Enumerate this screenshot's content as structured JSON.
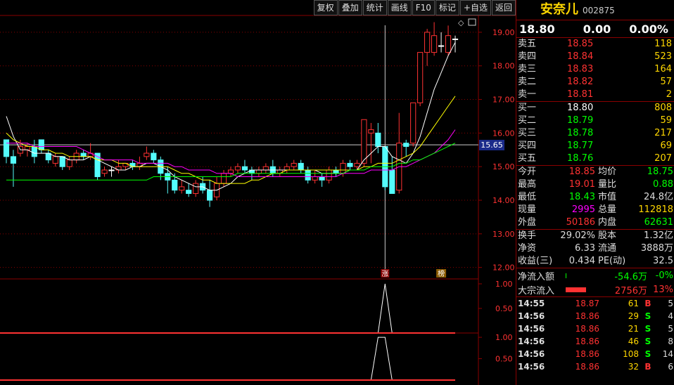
{
  "toolbar": {
    "buttons": [
      "复权",
      "叠加",
      "统计",
      "画线",
      "F10",
      "标记",
      "+自选",
      "返回"
    ]
  },
  "colors": {
    "up": "#ff3232",
    "down": "#54fcfc",
    "equal": "#ffffff",
    "ma5": "#ffffff",
    "ma10": "#ffff00",
    "ma20": "#ff00ff",
    "ma60": "#00ff00",
    "vol_bar": "#ff3232",
    "vol_line": "#ffffff"
  },
  "main_chart": {
    "y_ticks": [
      "19.00",
      "18.00",
      "17.00",
      "16.00",
      "15.00",
      "14.00",
      "13.00",
      "12.00"
    ],
    "price_line_label": "15.65",
    "markers": [
      "涨",
      "榜"
    ]
  },
  "indicator1": {
    "y_ticks": [
      "1.00",
      "0.50"
    ]
  },
  "indicator2": {
    "y_ticks": [
      "1.00",
      "0.50"
    ]
  },
  "chart_data": {
    "type": "candlestick",
    "ylim": [
      11.7,
      19.5
    ],
    "candles": [
      [
        15.8,
        15.3,
        15.8,
        15.1
      ],
      [
        15.3,
        15.1,
        15.5,
        14.4
      ],
      [
        15.4,
        15.6,
        15.8,
        15.3
      ],
      [
        15.5,
        15.6,
        15.7,
        15.3
      ],
      [
        15.6,
        15.3,
        15.8,
        15.1
      ],
      [
        15.8,
        15.5,
        15.8,
        15.4
      ],
      [
        15.4,
        15.2,
        15.5,
        15.1
      ],
      [
        15.1,
        15.3,
        15.4,
        15.0
      ],
      [
        15.3,
        15.0,
        15.3,
        14.9
      ],
      [
        15.0,
        15.2,
        15.3,
        14.9
      ],
      [
        15.2,
        15.4,
        15.5,
        15.1
      ],
      [
        15.4,
        15.3,
        15.5,
        15.2
      ],
      [
        15.3,
        15.4,
        15.7,
        15.2
      ],
      [
        15.4,
        14.7,
        15.4,
        14.6
      ],
      [
        14.8,
        14.9,
        15.0,
        14.7
      ],
      [
        14.9,
        14.9,
        15.0,
        14.7
      ],
      [
        14.9,
        15.0,
        15.2,
        14.8
      ],
      [
        15.0,
        15.1,
        15.1,
        14.9
      ],
      [
        15.1,
        15.0,
        15.2,
        14.9
      ],
      [
        15.0,
        15.1,
        15.3,
        14.9
      ],
      [
        15.3,
        15.4,
        15.6,
        15.2
      ],
      [
        15.4,
        15.2,
        15.5,
        15.1
      ],
      [
        15.2,
        14.8,
        15.3,
        14.6
      ],
      [
        14.8,
        14.6,
        15.0,
        14.2
      ],
      [
        14.6,
        14.3,
        14.8,
        14.2
      ],
      [
        14.3,
        14.4,
        14.6,
        14.2
      ],
      [
        14.3,
        14.2,
        14.5,
        14.1
      ],
      [
        14.2,
        14.5,
        14.6,
        14.1
      ],
      [
        14.5,
        14.3,
        14.7,
        14.2
      ],
      [
        14.3,
        14.0,
        14.6,
        13.8
      ],
      [
        14.1,
        14.5,
        14.7,
        14.0
      ],
      [
        14.5,
        14.8,
        14.9,
        14.4
      ],
      [
        14.8,
        14.9,
        15.0,
        14.7
      ],
      [
        14.9,
        15.0,
        15.1,
        14.8
      ],
      [
        15.0,
        14.9,
        15.2,
        14.8
      ],
      [
        14.9,
        14.8,
        15.0,
        14.6
      ],
      [
        14.8,
        14.9,
        15.0,
        14.7
      ],
      [
        14.9,
        15.0,
        15.1,
        14.8
      ],
      [
        15.0,
        14.8,
        15.2,
        14.7
      ],
      [
        14.8,
        14.9,
        15.0,
        14.7
      ],
      [
        14.9,
        15.0,
        15.1,
        14.8
      ],
      [
        15.0,
        15.1,
        15.2,
        14.9
      ],
      [
        15.1,
        14.9,
        15.2,
        14.8
      ],
      [
        14.9,
        14.6,
        15.0,
        14.5
      ],
      [
        14.6,
        14.7,
        14.9,
        14.5
      ],
      [
        14.7,
        14.6,
        14.8,
        14.4
      ],
      [
        14.6,
        14.9,
        15.0,
        14.5
      ],
      [
        14.9,
        14.8,
        15.0,
        14.7
      ],
      [
        14.8,
        15.1,
        15.2,
        14.7
      ],
      [
        15.1,
        15.0,
        15.2,
        14.9
      ],
      [
        15.0,
        15.1,
        15.2,
        14.9
      ],
      [
        15.1,
        16.4,
        16.4,
        15.0
      ],
      [
        16.0,
        16.1,
        16.3,
        15.1
      ],
      [
        16.0,
        15.6,
        16.3,
        15.4
      ],
      [
        15.6,
        14.4,
        15.6,
        14.3
      ],
      [
        14.9,
        14.2,
        15.3,
        14.2
      ],
      [
        14.3,
        15.7,
        16.6,
        14.2
      ],
      [
        15.7,
        15.6,
        15.8,
        15.3
      ],
      [
        15.7,
        16.9,
        16.9,
        15.6
      ],
      [
        16.9,
        18.4,
        18.4,
        16.8
      ],
      [
        18.4,
        19.0,
        19.1,
        18.0
      ],
      [
        18.4,
        18.9,
        19.3,
        18.3
      ],
      [
        18.6,
        18.6,
        19.0,
        18.4
      ],
      [
        18.4,
        18.9,
        19.2,
        18.3
      ],
      [
        18.8,
        18.8,
        18.9,
        18.4
      ]
    ],
    "ma": {
      "ma5": [
        16.5,
        15.9,
        15.5,
        15.5,
        15.4,
        15.4,
        15.4,
        15.3,
        15.3,
        15.2,
        15.2,
        15.2,
        15.3,
        15.2,
        15.1,
        15.0,
        14.9,
        14.9,
        15.0,
        15.0,
        15.1,
        15.1,
        15.0,
        14.9,
        14.7,
        14.6,
        14.5,
        14.4,
        14.4,
        14.3,
        14.3,
        14.4,
        14.5,
        14.7,
        14.8,
        14.9,
        14.9,
        14.9,
        14.9,
        14.9,
        14.9,
        14.9,
        14.9,
        14.9,
        14.9,
        14.8,
        14.8,
        14.8,
        14.8,
        14.9,
        14.9,
        15.2,
        15.4,
        15.6,
        15.6,
        15.3,
        15.2,
        15.1,
        15.4,
        15.9,
        16.6,
        17.3,
        17.8,
        18.3,
        18.7
      ],
      "ma10": [
        16.0,
        15.8,
        15.7,
        15.6,
        15.6,
        15.5,
        15.5,
        15.4,
        15.4,
        15.3,
        15.3,
        15.3,
        15.3,
        15.2,
        15.2,
        15.2,
        15.1,
        15.1,
        15.0,
        15.0,
        15.0,
        15.0,
        15.0,
        15.0,
        14.9,
        14.8,
        14.8,
        14.7,
        14.6,
        14.6,
        14.5,
        14.5,
        14.5,
        14.5,
        14.5,
        14.6,
        14.6,
        14.7,
        14.8,
        14.8,
        14.9,
        14.9,
        14.9,
        14.9,
        14.9,
        14.9,
        14.9,
        14.9,
        14.9,
        14.9,
        14.9,
        15.0,
        15.0,
        15.1,
        15.1,
        15.1,
        15.2,
        15.3,
        15.4,
        15.6,
        15.9,
        16.2,
        16.5,
        16.8,
        17.1
      ],
      "ma20": [
        15.7,
        15.7,
        15.7,
        15.7,
        15.6,
        15.6,
        15.6,
        15.6,
        15.6,
        15.6,
        15.6,
        15.5,
        15.4,
        15.3,
        15.2,
        15.2,
        15.2,
        15.2,
        15.2,
        15.1,
        15.1,
        15.1,
        15.1,
        15.1,
        15.0,
        15.0,
        14.9,
        14.9,
        14.9,
        14.9,
        14.8,
        14.8,
        14.8,
        14.7,
        14.7,
        14.7,
        14.7,
        14.7,
        14.7,
        14.7,
        14.7,
        14.7,
        14.7,
        14.7,
        14.7,
        14.7,
        14.7,
        14.7,
        14.8,
        14.8,
        14.8,
        14.8,
        14.9,
        14.9,
        14.9,
        14.9,
        15.0,
        15.0,
        15.1,
        15.2,
        15.3,
        15.4,
        15.6,
        15.8,
        16.1
      ],
      "ma60": [
        14.6,
        14.6,
        14.6,
        14.6,
        14.6,
        14.6,
        14.6,
        14.6,
        14.6,
        14.6,
        14.6,
        14.6,
        14.6,
        14.6,
        14.6,
        14.6,
        14.6,
        14.6,
        14.6,
        14.6,
        14.6,
        14.7,
        14.7,
        14.7,
        14.7,
        14.7,
        14.7,
        14.7,
        14.7,
        14.7,
        14.7,
        14.7,
        14.7,
        14.8,
        14.8,
        14.8,
        14.8,
        14.8,
        14.8,
        14.8,
        14.8,
        14.8,
        14.8,
        14.8,
        14.8,
        14.8,
        14.8,
        14.8,
        14.8,
        14.9,
        14.9,
        14.9,
        15.0,
        15.0,
        15.0,
        15.0,
        15.1,
        15.1,
        15.2,
        15.2,
        15.3,
        15.4,
        15.5,
        15.6,
        15.7
      ]
    },
    "ind1": [
      0,
      0,
      0,
      0,
      0,
      0,
      0,
      0,
      0,
      0,
      0,
      0,
      0,
      0,
      0,
      0,
      0,
      0,
      0,
      0,
      0,
      0,
      0,
      0,
      0,
      0,
      0,
      0,
      0,
      0,
      0,
      0,
      0,
      0,
      0,
      0,
      0,
      0,
      0,
      0,
      0,
      0,
      0,
      0,
      0,
      0,
      0,
      0,
      0,
      0,
      0,
      0,
      0,
      0,
      1,
      0,
      0,
      0,
      0,
      0,
      0,
      0,
      0,
      0,
      0
    ],
    "ind2": [
      0,
      0,
      0,
      0,
      0,
      0,
      0,
      0,
      0,
      0,
      0,
      0,
      0,
      0,
      0,
      0,
      0,
      0,
      0,
      0,
      0,
      0,
      0,
      0,
      0,
      0,
      0,
      0,
      0,
      0,
      0,
      0,
      0,
      0,
      0,
      0,
      0,
      0,
      0,
      0,
      0,
      0,
      0,
      0,
      0,
      0,
      0,
      0,
      0,
      0,
      0,
      0,
      0,
      1,
      1,
      0,
      0,
      0,
      0,
      0,
      0,
      0,
      0,
      0,
      0
    ],
    "ind_ylim": [
      0,
      1.1
    ]
  },
  "stock": {
    "name": "安奈儿",
    "code": "002875"
  },
  "quote": {
    "last": "18.80",
    "change": "0.00",
    "pct": "0.00%"
  },
  "orderbook": {
    "sell": [
      {
        "label": "卖五",
        "price": "18.85",
        "vol": "118"
      },
      {
        "label": "卖四",
        "price": "18.84",
        "vol": "523"
      },
      {
        "label": "卖三",
        "price": "18.83",
        "vol": "164"
      },
      {
        "label": "卖二",
        "price": "18.82",
        "vol": "57"
      },
      {
        "label": "卖一",
        "price": "18.81",
        "vol": "2"
      }
    ],
    "buy": [
      {
        "label": "买一",
        "price": "18.80",
        "vol": "808"
      },
      {
        "label": "买二",
        "price": "18.79",
        "vol": "59"
      },
      {
        "label": "买三",
        "price": "18.78",
        "vol": "217"
      },
      {
        "label": "买四",
        "price": "18.77",
        "vol": "69"
      },
      {
        "label": "买五",
        "price": "18.76",
        "vol": "207"
      }
    ]
  },
  "stats1": [
    {
      "k1": "今开",
      "v1": "18.85",
      "c1": "#ff3232",
      "k2": "均价",
      "v2": "18.75",
      "c2": "#00ff00"
    },
    {
      "k1": "最高",
      "v1": "19.01",
      "c1": "#ff3232",
      "k2": "量比",
      "v2": "0.88",
      "c2": "#00ff00"
    },
    {
      "k1": "最低",
      "v1": "18.43",
      "c1": "#00ff00",
      "k2": "市值",
      "v2": "24.8亿",
      "c2": "#dddddd"
    },
    {
      "k1": "现量",
      "v1": "2995",
      "c1": "#ff00ff",
      "k2": "总量",
      "v2": "112818",
      "c2": "#ffd700"
    },
    {
      "k1": "外盘",
      "v1": "50186",
      "c1": "#ff3232",
      "k2": "内盘",
      "v2": "62631",
      "c2": "#00ff00"
    }
  ],
  "stats2": [
    {
      "k1": "换手",
      "v1": "29.02%",
      "k2": "股本",
      "v2": "1.32亿"
    },
    {
      "k1": "净资",
      "v1": "6.33",
      "k2": "流通",
      "v2": "3888万"
    },
    {
      "k1": "收益(三)",
      "v1": "0.434",
      "k2": "PE(动)",
      "v2": "32.5"
    }
  ],
  "flow": [
    {
      "label": "净流入额",
      "value": "-54.6万",
      "pct": "-0%",
      "color": "#00ff00",
      "bar": 0.01
    },
    {
      "label": "大宗流入",
      "value": "2756万",
      "pct": "13%",
      "color": "#ff3232",
      "bar": 0.6
    }
  ],
  "trades": [
    {
      "time": "14:55",
      "price": "18.87",
      "vol": "61",
      "bs": "B",
      "n": "5"
    },
    {
      "time": "14:56",
      "price": "18.86",
      "vol": "29",
      "bs": "S",
      "n": "4"
    },
    {
      "time": "14:56",
      "price": "18.86",
      "vol": "21",
      "bs": "S",
      "n": "5"
    },
    {
      "time": "14:56",
      "price": "18.86",
      "vol": "46",
      "bs": "S",
      "n": "8"
    },
    {
      "time": "14:56",
      "price": "18.86",
      "vol": "108",
      "bs": "S",
      "n": "14"
    },
    {
      "time": "14:56",
      "price": "18.86",
      "vol": "32",
      "bs": "B",
      "n": "6"
    }
  ]
}
